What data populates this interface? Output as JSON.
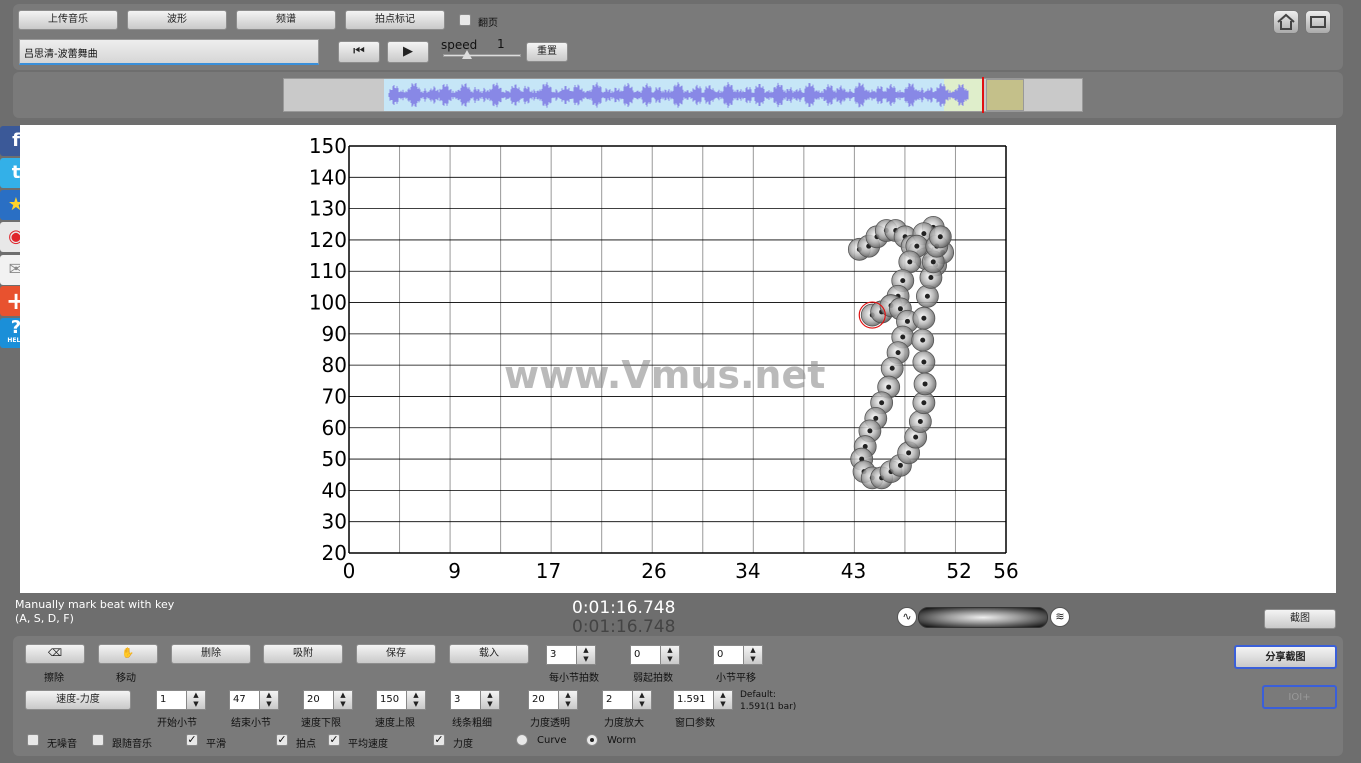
{
  "toolbar": {
    "upload_label": "上传音乐",
    "waveform_label": "波形",
    "spectrum_label": "频谱",
    "beat_mark_label": "拍点标记",
    "flip_label": "翻页",
    "speed_label": "speed",
    "speed_value": "1",
    "reset_label": "重置",
    "song_title": "吕思清-波蕾舞曲"
  },
  "colors": {
    "waveform": "#8888e6",
    "selection": "#c6e6f7",
    "playhead": "#e01010",
    "accent": "#3a5fd9"
  },
  "watermark": "www.Vmus.net",
  "status": {
    "hint_line1": "Manually mark beat with key",
    "hint_line2": "(A, S, D, F)",
    "time1": "0:01:16.748",
    "time2": "0:01:16.748",
    "screenshot_label": "截图"
  },
  "controls": {
    "erase_label": "擦除",
    "move_label": "移动",
    "delete_label": "删除",
    "snap_label": "吸附",
    "save_label": "保存",
    "load_label": "载入",
    "share_label": "分享截图",
    "ioi_label": "IOI+",
    "mode_label": "速度-力度",
    "default_line1": "Default:",
    "default_line2": "1.591(1 bar)",
    "beats_per_bar": {
      "label": "每小节拍数",
      "value": "3"
    },
    "pickup_beats": {
      "label": "弱起拍数",
      "value": "0"
    },
    "bar_shift": {
      "label": "小节平移",
      "value": "0"
    },
    "start_bar": {
      "label": "开始小节",
      "value": "1"
    },
    "end_bar": {
      "label": "结束小节",
      "value": "47"
    },
    "tempo_min": {
      "label": "速度下限",
      "value": "20"
    },
    "tempo_max": {
      "label": "速度上限",
      "value": "150"
    },
    "line_width": {
      "label": "线条粗细",
      "value": "3"
    },
    "dyn_transp": {
      "label": "力度透明",
      "value": "20"
    },
    "dyn_scale": {
      "label": "力度放大",
      "value": "2"
    },
    "window_param": {
      "label": "窗口参数",
      "value": "1.591"
    },
    "checkboxes": [
      {
        "label": "无噪音",
        "checked": false
      },
      {
        "label": "跟随音乐",
        "checked": false
      },
      {
        "label": "平滑",
        "checked": true
      },
      {
        "label": "拍点",
        "checked": true
      },
      {
        "label": "平均速度",
        "checked": true
      },
      {
        "label": "力度",
        "checked": true
      }
    ],
    "radios": [
      {
        "label": "Curve",
        "checked": false
      },
      {
        "label": "Worm",
        "checked": true
      }
    ]
  },
  "social_icons": [
    "facebook-icon",
    "twitter-icon",
    "favorite-icon",
    "weibo-icon",
    "mail-icon",
    "share-plus-icon",
    "help-icon"
  ],
  "help_badge": "HELP",
  "chart_data": {
    "type": "scatter",
    "xlim": [
      0,
      56
    ],
    "ylim": [
      20,
      150
    ],
    "x_ticks": [
      "0",
      "9",
      "17",
      "26",
      "34",
      "43",
      "52",
      "56"
    ],
    "y_ticks": [
      "150",
      "140",
      "130",
      "120",
      "110",
      "100",
      "90",
      "80",
      "70",
      "60",
      "50",
      "40",
      "30",
      "20"
    ],
    "grid": true,
    "points": [
      {
        "x": 43.5,
        "y": 117
      },
      {
        "x": 44.3,
        "y": 118
      },
      {
        "x": 45.0,
        "y": 121
      },
      {
        "x": 45.8,
        "y": 123
      },
      {
        "x": 46.6,
        "y": 123
      },
      {
        "x": 47.4,
        "y": 121
      },
      {
        "x": 48.0,
        "y": 118
      },
      {
        "x": 48.6,
        "y": 116
      },
      {
        "x": 49.2,
        "y": 114
      },
      {
        "x": 50.0,
        "y": 112
      },
      {
        "x": 50.6,
        "y": 116
      },
      {
        "x": 50.3,
        "y": 121
      },
      {
        "x": 49.8,
        "y": 124
      },
      {
        "x": 49.0,
        "y": 122
      },
      {
        "x": 48.4,
        "y": 118
      },
      {
        "x": 47.8,
        "y": 113
      },
      {
        "x": 47.2,
        "y": 107
      },
      {
        "x": 46.8,
        "y": 102
      },
      {
        "x": 46.2,
        "y": 99
      },
      {
        "x": 45.4,
        "y": 97
      },
      {
        "x": 44.6,
        "y": 96
      },
      {
        "x": 45.4,
        "y": 97
      },
      {
        "x": 46.2,
        "y": 99
      },
      {
        "x": 47.0,
        "y": 98
      },
      {
        "x": 47.6,
        "y": 94
      },
      {
        "x": 47.2,
        "y": 89
      },
      {
        "x": 46.8,
        "y": 84
      },
      {
        "x": 46.3,
        "y": 79
      },
      {
        "x": 46.0,
        "y": 73
      },
      {
        "x": 45.4,
        "y": 68
      },
      {
        "x": 44.9,
        "y": 63
      },
      {
        "x": 44.4,
        "y": 59
      },
      {
        "x": 44.0,
        "y": 54
      },
      {
        "x": 43.7,
        "y": 50
      },
      {
        "x": 43.9,
        "y": 46
      },
      {
        "x": 44.6,
        "y": 44
      },
      {
        "x": 45.4,
        "y": 44
      },
      {
        "x": 46.2,
        "y": 46
      },
      {
        "x": 47.0,
        "y": 48
      },
      {
        "x": 47.7,
        "y": 52
      },
      {
        "x": 48.3,
        "y": 57
      },
      {
        "x": 48.7,
        "y": 62
      },
      {
        "x": 49.0,
        "y": 68
      },
      {
        "x": 49.1,
        "y": 74
      },
      {
        "x": 49.0,
        "y": 81
      },
      {
        "x": 48.9,
        "y": 88
      },
      {
        "x": 49.0,
        "y": 95
      },
      {
        "x": 49.3,
        "y": 102
      },
      {
        "x": 49.6,
        "y": 108
      },
      {
        "x": 49.8,
        "y": 113
      },
      {
        "x": 50.1,
        "y": 118
      },
      {
        "x": 50.4,
        "y": 121
      }
    ],
    "marker": {
      "x": 44.6,
      "y": 96
    }
  }
}
